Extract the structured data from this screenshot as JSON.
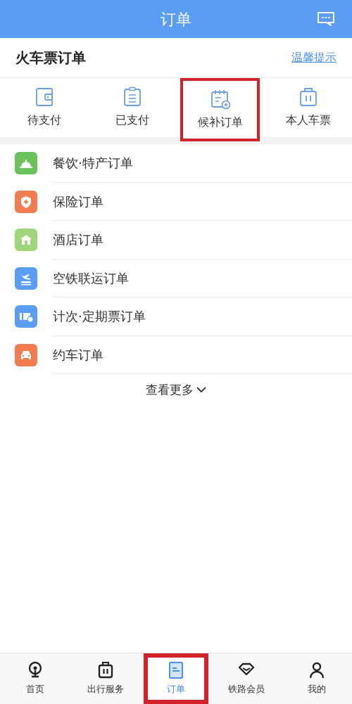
{
  "header": {
    "title": "订单"
  },
  "section": {
    "title": "火车票订单",
    "link": "温馨提示"
  },
  "quick_actions": [
    {
      "label": "待支付",
      "kind": "wallet",
      "highlighted": false
    },
    {
      "label": "已支付",
      "kind": "clipboard",
      "highlighted": false
    },
    {
      "label": "候补订单",
      "kind": "calendar",
      "highlighted": true
    },
    {
      "label": "本人车票",
      "kind": "suitcase",
      "highlighted": false
    }
  ],
  "orders": [
    {
      "label": "餐饮·特产订单",
      "kind": "bell",
      "color": "#6cc25a"
    },
    {
      "label": "保险订单",
      "kind": "shield",
      "color": "#f07c4f"
    },
    {
      "label": "酒店订单",
      "kind": "house",
      "color": "#9fd67a"
    },
    {
      "label": "空铁联运订单",
      "kind": "plane",
      "color": "#5b9cf5"
    },
    {
      "label": "计次·定期票订单",
      "kind": "ticket",
      "color": "#5b9cf5"
    },
    {
      "label": "约车订单",
      "kind": "car",
      "color": "#f07c4f"
    }
  ],
  "more": {
    "label": "查看更多"
  },
  "tabs": [
    {
      "label": "首页",
      "kind": "home",
      "selected": false,
      "highlighted": false
    },
    {
      "label": "出行服务",
      "kind": "suitcase",
      "selected": false,
      "highlighted": false
    },
    {
      "label": "订单",
      "kind": "order",
      "selected": true,
      "highlighted": true
    },
    {
      "label": "铁路会员",
      "kind": "diamond",
      "selected": false,
      "highlighted": false
    },
    {
      "label": "我的",
      "kind": "person",
      "selected": false,
      "highlighted": false
    }
  ]
}
